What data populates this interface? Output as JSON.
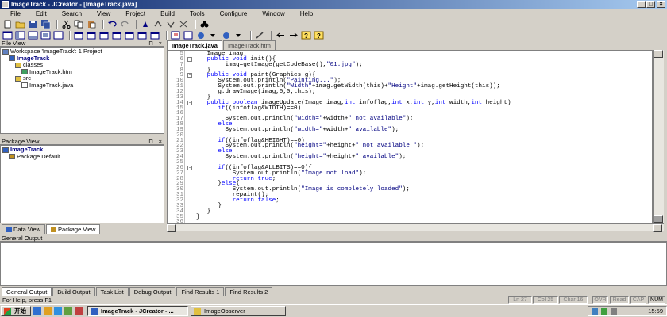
{
  "window": {
    "title": "ImageTrack - JCreator - [ImageTrack.java]",
    "min": "_",
    "max": "□",
    "close": "×"
  },
  "menu": [
    "File",
    "Edit",
    "Search",
    "View",
    "Project",
    "Build",
    "Tools",
    "Configure",
    "Window",
    "Help"
  ],
  "file_view": {
    "header": "File View",
    "items": [
      {
        "label": "Workspace 'ImageTrack': 1 Project",
        "indent": 0,
        "icon": "workspace-icon"
      },
      {
        "label": "ImageTrack",
        "indent": 1,
        "icon": "project-icon",
        "bold": true
      },
      {
        "label": "classes",
        "indent": 2,
        "icon": "folder-icon"
      },
      {
        "label": "ImageTrack.htm",
        "indent": 3,
        "icon": "html-file-icon"
      },
      {
        "label": "src",
        "indent": 2,
        "icon": "folder-icon"
      },
      {
        "label": "ImageTrack.java",
        "indent": 3,
        "icon": "java-file-icon"
      }
    ]
  },
  "package_view": {
    "header": "Package View",
    "items": [
      {
        "label": "ImageTrack",
        "indent": 0,
        "icon": "project-icon",
        "bold": true
      },
      {
        "label": "Package Default",
        "indent": 1,
        "icon": "package-icon"
      }
    ]
  },
  "left_tabs": [
    "Data View",
    "Package View"
  ],
  "editor_tabs": [
    "ImageTrack.java",
    "ImageTrack.htm"
  ],
  "code_lines": [
    {
      "n": "5",
      "t": "   Image imag;"
    },
    {
      "n": "6",
      "t": "   public void init(){"
    },
    {
      "n": "7",
      "t": "        imag=getImage(getCodeBase(),\"01.jpg\");"
    },
    {
      "n": "8",
      "t": "   }"
    },
    {
      "n": "9",
      "t": "   public void paint(Graphics g){"
    },
    {
      "n": "10",
      "t": "      System.out.println(\"Painting...\");"
    },
    {
      "n": "11",
      "t": "      System.out.println(\"Width\"+imag.getWidth(this)+\"Height\"+imag.getHeight(this));"
    },
    {
      "n": "12",
      "t": "      g.drawImage(imag,0,0,this);"
    },
    {
      "n": "13",
      "t": "   }"
    },
    {
      "n": "14",
      "t": "   public boolean imageUpdate(Image imag,int infoflag,int x,int y,int width,int height)"
    },
    {
      "n": "15",
      "t": "      if((infoflag&WIDTH)==0)"
    },
    {
      "n": "16",
      "t": ""
    },
    {
      "n": "17",
      "t": "        System.out.println(\"width=\"+width+\" not available\");"
    },
    {
      "n": "18",
      "t": "      else"
    },
    {
      "n": "19",
      "t": "        System.out.println(\"width=\"+width+\" available\");"
    },
    {
      "n": "20",
      "t": ""
    },
    {
      "n": "21",
      "t": "      if((infoflag&HEIGHT)==0)"
    },
    {
      "n": "22",
      "t": "        System.out.println(\"height=\"+height+\" not available \");"
    },
    {
      "n": "23",
      "t": "      else"
    },
    {
      "n": "24",
      "t": "        System.out.println(\"height=\"+height+\" available\");"
    },
    {
      "n": "25",
      "t": ""
    },
    {
      "n": "26",
      "t": "      if((infoflag&ALLBITS)==0){"
    },
    {
      "n": "27",
      "t": "          System.out.println(\"Image not load\");"
    },
    {
      "n": "28",
      "t": "          return true;"
    },
    {
      "n": "29",
      "t": "      }else{"
    },
    {
      "n": "30",
      "t": "          System.out.println(\"Image is completely loaded\");"
    },
    {
      "n": "31",
      "t": "          repaint();"
    },
    {
      "n": "32",
      "t": "          return false;"
    },
    {
      "n": "33",
      "t": "      }"
    },
    {
      "n": "34",
      "t": "   }"
    },
    {
      "n": "35",
      "t": "}"
    },
    {
      "n": "36",
      "t": ""
    }
  ],
  "output": {
    "header": "General Output",
    "tabs": [
      "General Output",
      "Build Output",
      "Task List",
      "Debug Output",
      "Find Results 1",
      "Find Results 2"
    ]
  },
  "status": {
    "help": "For Help, press F1",
    "ln": "Ln 27",
    "col": "Col 25",
    "char": "Char 16",
    "ovr": "OVR",
    "read": "Read",
    "caps": "CAP",
    "num": "NUM"
  },
  "taskbar": {
    "start": "开始",
    "tasks": [
      "ImageTrack - JCreator - ...",
      "ImageObserver"
    ],
    "clock": "15:59"
  },
  "colors": {
    "keyword": "#0000ff",
    "title_active": "#0a246a"
  }
}
